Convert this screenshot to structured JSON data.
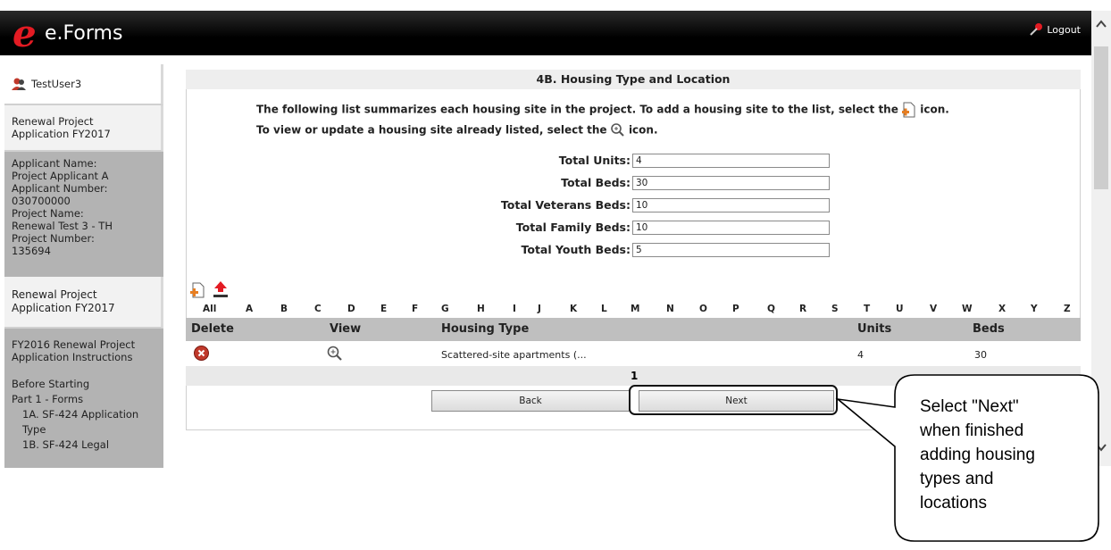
{
  "header": {
    "logo_letter": "e",
    "logo_text": "e.Forms",
    "logout_label": "Logout"
  },
  "sidebar": {
    "user": "TestUser3",
    "application": "Renewal Project Application FY2017",
    "applicant_name_label": "Applicant Name:",
    "applicant_name": "Project Applicant A",
    "applicant_number_label": "Applicant Number:",
    "applicant_number": "030700000",
    "project_name_label": "Project Name:",
    "project_name": "Renewal Test 3 - TH",
    "project_number_label": "Project Number:",
    "project_number": "135694",
    "renewal_link": "Renewal Project Application FY2017",
    "instructions_link": "FY2016 Renewal Project Application Instructions",
    "nav": [
      "Before Starting",
      "Part 1 - Forms",
      "1A. SF-424 Application Type",
      "1B. SF-424 Legal"
    ]
  },
  "main": {
    "title": "4B. Housing Type and Location",
    "intro_line1_pre": "The following list summarizes each housing site in the project. To add a housing site to the list, select the",
    "intro_line1_post": "icon.",
    "intro_line2_pre": "To view or update a housing site already listed, select the",
    "intro_line2_post": "icon.",
    "fields": [
      {
        "label": "Total Units:",
        "value": "4"
      },
      {
        "label": "Total Beds:",
        "value": "30"
      },
      {
        "label": "Total Veterans Beds:",
        "value": "10"
      },
      {
        "label": "Total Family Beds:",
        "value": "10"
      },
      {
        "label": "Total Youth Beds:",
        "value": "5"
      }
    ],
    "alphabet": [
      "All",
      "A",
      "B",
      "C",
      "D",
      "E",
      "F",
      "G",
      "H",
      "I",
      "J",
      "K",
      "L",
      "M",
      "N",
      "O",
      "P",
      "Q",
      "R",
      "S",
      "T",
      "U",
      "V",
      "W",
      "X",
      "Y",
      "Z"
    ],
    "columns": {
      "delete": "Delete",
      "view": "View",
      "housing_type": "Housing Type",
      "units": "Units",
      "beds": "Beds"
    },
    "rows": [
      {
        "housing_type": "Scattered-site apartments (...",
        "units": "4",
        "beds": "30"
      }
    ],
    "page": "1",
    "back_label": "Back",
    "next_label": "Next"
  },
  "callout": {
    "lines": [
      "Select \"Next\"",
      "when finished",
      "adding housing",
      "types and",
      "locations"
    ]
  }
}
